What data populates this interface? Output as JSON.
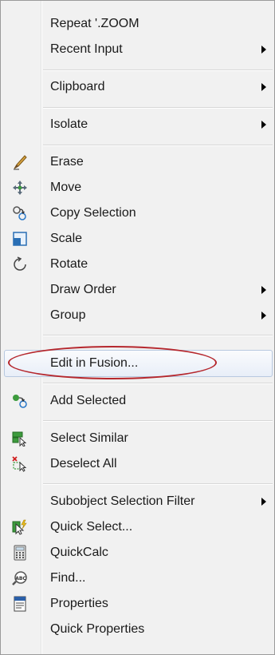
{
  "menu": {
    "items": [
      {
        "label": "Repeat '.ZOOM",
        "submenu": false
      },
      {
        "label": "Recent Input",
        "submenu": true
      },
      {
        "label": "Clipboard",
        "submenu": true
      },
      {
        "label": "Isolate",
        "submenu": true
      },
      {
        "label": "Erase",
        "icon": "eraser-icon",
        "submenu": false
      },
      {
        "label": "Move",
        "icon": "move-icon",
        "submenu": false
      },
      {
        "label": "Copy Selection",
        "icon": "copy-selection-icon",
        "submenu": false
      },
      {
        "label": "Scale",
        "icon": "scale-icon",
        "submenu": false
      },
      {
        "label": "Rotate",
        "icon": "rotate-icon",
        "submenu": false
      },
      {
        "label": "Draw Order",
        "submenu": true
      },
      {
        "label": "Group",
        "submenu": true
      },
      {
        "label": "Edit in Fusion...",
        "submenu": false,
        "highlighted": true
      },
      {
        "label": "Add Selected",
        "icon": "add-selected-icon",
        "submenu": false
      },
      {
        "label": "Select Similar",
        "icon": "select-similar-icon",
        "submenu": false
      },
      {
        "label": "Deselect All",
        "icon": "deselect-all-icon",
        "submenu": false
      },
      {
        "label": "Subobject Selection Filter",
        "submenu": true
      },
      {
        "label": "Quick Select...",
        "icon": "quick-select-icon",
        "submenu": false
      },
      {
        "label": "QuickCalc",
        "icon": "calculator-icon",
        "submenu": false
      },
      {
        "label": "Find...",
        "icon": "find-icon",
        "submenu": false
      },
      {
        "label": "Properties",
        "icon": "properties-icon",
        "submenu": false
      },
      {
        "label": "Quick Properties",
        "submenu": false
      }
    ]
  },
  "colors": {
    "annotation_oval": "#b5272d",
    "menu_background": "#f1f1f1"
  }
}
